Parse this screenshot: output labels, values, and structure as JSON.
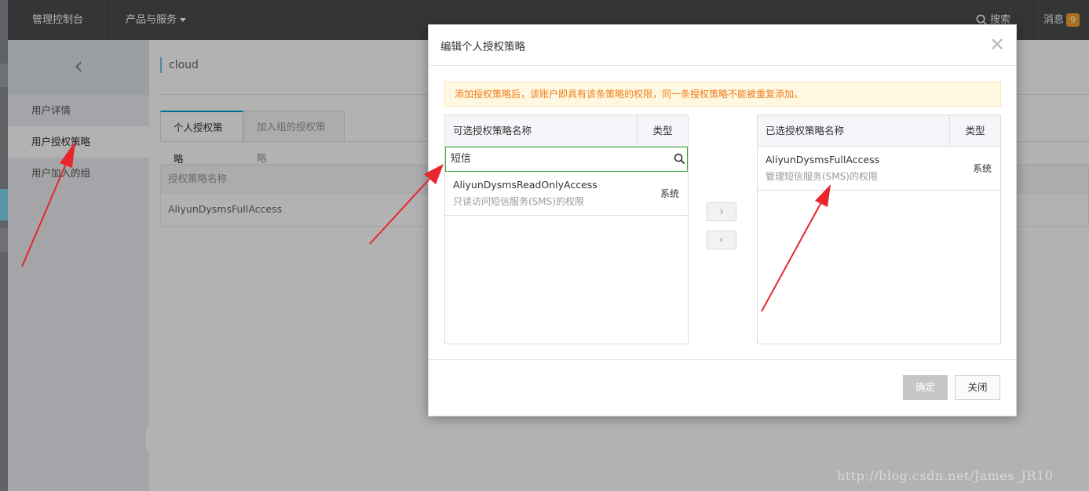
{
  "topbar": {
    "console": "管理控制台",
    "products": "产品与服务",
    "search": "搜索",
    "messages": "消息",
    "message_count": "9"
  },
  "sidebar": {
    "items": [
      {
        "label": "用户详情"
      },
      {
        "label": "用户授权策略"
      },
      {
        "label": "用户加入的组"
      }
    ]
  },
  "main": {
    "breadcrumb": "cloud",
    "tabs": [
      {
        "label": "个人授权策略"
      },
      {
        "label": "加入组的授权策略"
      }
    ],
    "table": {
      "header": "授权策略名称",
      "rows": [
        "AliyunDysmsFullAccess"
      ]
    }
  },
  "modal": {
    "title": "编辑个人授权策略",
    "notice": "添加授权策略后，该账户即具有该条策略的权限，同一条授权策略不能被重复添加。",
    "available": {
      "name_header": "可选授权策略名称",
      "type_header": "类型",
      "search_value": "短信",
      "items": [
        {
          "name": "AliyunDysmsReadOnlyAccess",
          "desc": "只读访问短信服务(SMS)的权限",
          "type": "系统"
        }
      ]
    },
    "selected": {
      "name_header": "已选授权策略名称",
      "type_header": "类型",
      "items": [
        {
          "name": "AliyunDysmsFullAccess",
          "desc": "管理短信服务(SMS)的权限",
          "type": "系统"
        }
      ]
    },
    "move_right": "›",
    "move_left": "‹",
    "ok_label": "确定",
    "close_label": "关闭"
  },
  "watermark": "http://blog.csdn.net/James_JR10",
  "colors": {
    "topbar_bg": "#4a4c50",
    "accent": "#00a2ca",
    "notice_text": "#f07d1b",
    "badge": "#f0a32c",
    "search_border": "#3fac3a",
    "annotation_arrow": "#e8262d"
  }
}
